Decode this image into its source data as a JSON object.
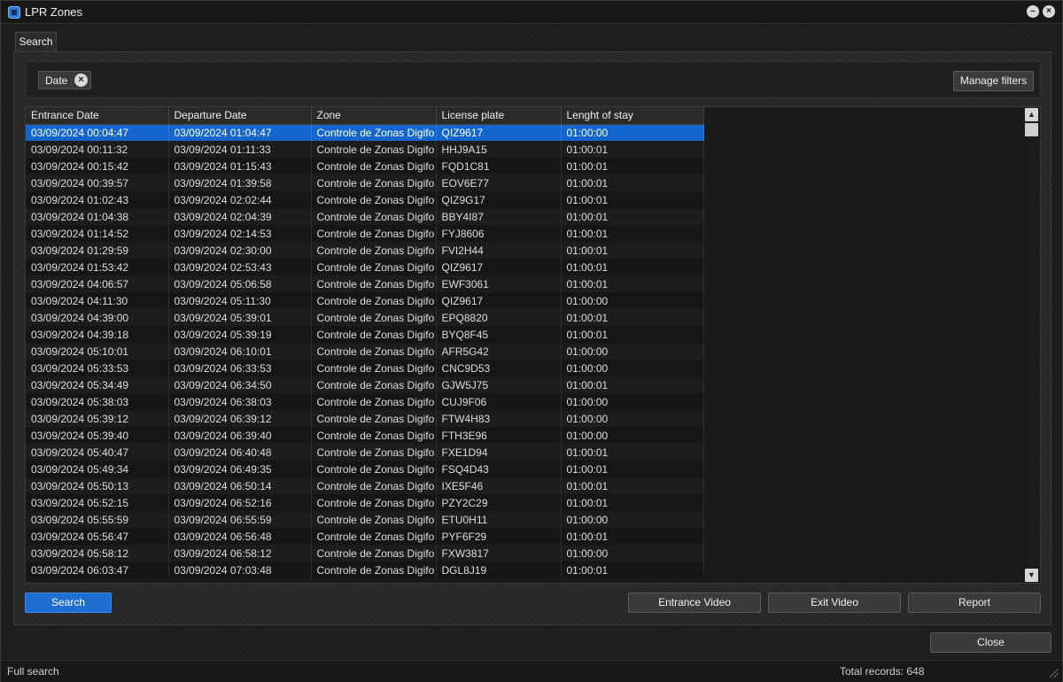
{
  "window": {
    "title": "LPR Zones"
  },
  "tabs": [
    {
      "label": "Search"
    }
  ],
  "filters": {
    "chips": [
      {
        "label": "Date"
      }
    ],
    "manage_label": "Manage filters"
  },
  "table": {
    "columns": [
      "Entrance Date",
      "Departure Date",
      "Zone",
      "License plate",
      "Lenght of stay"
    ],
    "rows": [
      [
        "03/09/2024 00:04:47",
        "03/09/2024 01:04:47",
        "Controle de Zonas Digifo",
        "QIZ9617",
        "01:00:00"
      ],
      [
        "03/09/2024 00:11:32",
        "03/09/2024 01:11:33",
        "Controle de Zonas Digifo",
        "HHJ9A15",
        "01:00:01"
      ],
      [
        "03/09/2024 00:15:42",
        "03/09/2024 01:15:43",
        "Controle de Zonas Digifo",
        "FQD1C81",
        "01:00:01"
      ],
      [
        "03/09/2024 00:39:57",
        "03/09/2024 01:39:58",
        "Controle de Zonas Digifo",
        "EOV6E77",
        "01:00:01"
      ],
      [
        "03/09/2024 01:02:43",
        "03/09/2024 02:02:44",
        "Controle de Zonas Digifo",
        "QIZ9G17",
        "01:00:01"
      ],
      [
        "03/09/2024 01:04:38",
        "03/09/2024 02:04:39",
        "Controle de Zonas Digifo",
        "BBY4I87",
        "01:00:01"
      ],
      [
        "03/09/2024 01:14:52",
        "03/09/2024 02:14:53",
        "Controle de Zonas Digifo",
        "FYJ8606",
        "01:00:01"
      ],
      [
        "03/09/2024 01:29:59",
        "03/09/2024 02:30:00",
        "Controle de Zonas Digifo",
        "FVI2H44",
        "01:00:01"
      ],
      [
        "03/09/2024 01:53:42",
        "03/09/2024 02:53:43",
        "Controle de Zonas Digifo",
        "QIZ9617",
        "01:00:01"
      ],
      [
        "03/09/2024 04:06:57",
        "03/09/2024 05:06:58",
        "Controle de Zonas Digifo",
        "EWF3061",
        "01:00:01"
      ],
      [
        "03/09/2024 04:11:30",
        "03/09/2024 05:11:30",
        "Controle de Zonas Digifo",
        "QIZ9617",
        "01:00:00"
      ],
      [
        "03/09/2024 04:39:00",
        "03/09/2024 05:39:01",
        "Controle de Zonas Digifo",
        "EPQ8820",
        "01:00:01"
      ],
      [
        "03/09/2024 04:39:18",
        "03/09/2024 05:39:19",
        "Controle de Zonas Digifo",
        "BYQ8F45",
        "01:00:01"
      ],
      [
        "03/09/2024 05:10:01",
        "03/09/2024 06:10:01",
        "Controle de Zonas Digifo",
        "AFR5G42",
        "01:00:00"
      ],
      [
        "03/09/2024 05:33:53",
        "03/09/2024 06:33:53",
        "Controle de Zonas Digifo",
        "CNC9D53",
        "01:00:00"
      ],
      [
        "03/09/2024 05:34:49",
        "03/09/2024 06:34:50",
        "Controle de Zonas Digifo",
        "GJW5J75",
        "01:00:01"
      ],
      [
        "03/09/2024 05:38:03",
        "03/09/2024 06:38:03",
        "Controle de Zonas Digifo",
        "CUJ9F06",
        "01:00:00"
      ],
      [
        "03/09/2024 05:39:12",
        "03/09/2024 06:39:12",
        "Controle de Zonas Digifo",
        "FTW4H83",
        "01:00:00"
      ],
      [
        "03/09/2024 05:39:40",
        "03/09/2024 06:39:40",
        "Controle de Zonas Digifo",
        "FTH3E96",
        "01:00:00"
      ],
      [
        "03/09/2024 05:40:47",
        "03/09/2024 06:40:48",
        "Controle de Zonas Digifo",
        "FXE1D94",
        "01:00:01"
      ],
      [
        "03/09/2024 05:49:34",
        "03/09/2024 06:49:35",
        "Controle de Zonas Digifo",
        "FSQ4D43",
        "01:00:01"
      ],
      [
        "03/09/2024 05:50:13",
        "03/09/2024 06:50:14",
        "Controle de Zonas Digifo",
        "IXE5F46",
        "01:00:01"
      ],
      [
        "03/09/2024 05:52:15",
        "03/09/2024 06:52:16",
        "Controle de Zonas Digifo",
        "PZY2C29",
        "01:00:01"
      ],
      [
        "03/09/2024 05:55:59",
        "03/09/2024 06:55:59",
        "Controle de Zonas Digifo",
        "ETU0H11",
        "01:00:00"
      ],
      [
        "03/09/2024 05:56:47",
        "03/09/2024 06:56:48",
        "Controle de Zonas Digifo",
        "PYF6F29",
        "01:00:01"
      ],
      [
        "03/09/2024 05:58:12",
        "03/09/2024 06:58:12",
        "Controle de Zonas Digifo",
        "FXW3817",
        "01:00:00"
      ],
      [
        "03/09/2024 06:03:47",
        "03/09/2024 07:03:48",
        "Controle de Zonas Digifo",
        "DGL8J19",
        "01:00:01"
      ]
    ],
    "selected_row": 0
  },
  "actions": {
    "search_label": "Search",
    "entrance_video_label": "Entrance Video",
    "exit_video_label": "Exit Video",
    "report_label": "Report",
    "close_label": "Close"
  },
  "status": {
    "left": "Full search",
    "right": "Total records: 648"
  },
  "colors": {
    "accent": "#1466cc",
    "search_button": "#1f6fd2"
  },
  "icons": {
    "app": "app-icon",
    "chip_remove": "close-circle-icon",
    "minimize": "minimize-icon",
    "close": "close-icon",
    "scroll_up": "chevron-up-icon",
    "scroll_down": "chevron-down-icon"
  }
}
